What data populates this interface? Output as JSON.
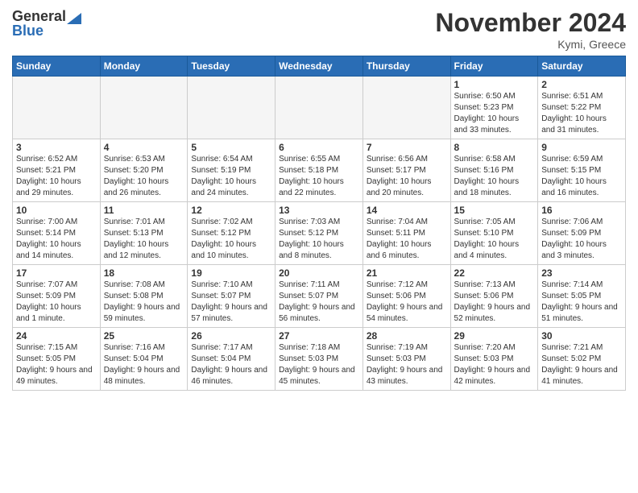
{
  "header": {
    "logo_general": "General",
    "logo_blue": "Blue",
    "title": "November 2024",
    "location": "Kymi, Greece"
  },
  "days_of_week": [
    "Sunday",
    "Monday",
    "Tuesday",
    "Wednesday",
    "Thursday",
    "Friday",
    "Saturday"
  ],
  "weeks": [
    [
      {
        "day": "",
        "empty": true
      },
      {
        "day": "",
        "empty": true
      },
      {
        "day": "",
        "empty": true
      },
      {
        "day": "",
        "empty": true
      },
      {
        "day": "",
        "empty": true
      },
      {
        "day": "1",
        "sunrise": "6:50 AM",
        "sunset": "5:23 PM",
        "daylight": "10 hours and 33 minutes."
      },
      {
        "day": "2",
        "sunrise": "6:51 AM",
        "sunset": "5:22 PM",
        "daylight": "10 hours and 31 minutes."
      }
    ],
    [
      {
        "day": "3",
        "sunrise": "6:52 AM",
        "sunset": "5:21 PM",
        "daylight": "10 hours and 29 minutes."
      },
      {
        "day": "4",
        "sunrise": "6:53 AM",
        "sunset": "5:20 PM",
        "daylight": "10 hours and 26 minutes."
      },
      {
        "day": "5",
        "sunrise": "6:54 AM",
        "sunset": "5:19 PM",
        "daylight": "10 hours and 24 minutes."
      },
      {
        "day": "6",
        "sunrise": "6:55 AM",
        "sunset": "5:18 PM",
        "daylight": "10 hours and 22 minutes."
      },
      {
        "day": "7",
        "sunrise": "6:56 AM",
        "sunset": "5:17 PM",
        "daylight": "10 hours and 20 minutes."
      },
      {
        "day": "8",
        "sunrise": "6:58 AM",
        "sunset": "5:16 PM",
        "daylight": "10 hours and 18 minutes."
      },
      {
        "day": "9",
        "sunrise": "6:59 AM",
        "sunset": "5:15 PM",
        "daylight": "10 hours and 16 minutes."
      }
    ],
    [
      {
        "day": "10",
        "sunrise": "7:00 AM",
        "sunset": "5:14 PM",
        "daylight": "10 hours and 14 minutes."
      },
      {
        "day": "11",
        "sunrise": "7:01 AM",
        "sunset": "5:13 PM",
        "daylight": "10 hours and 12 minutes."
      },
      {
        "day": "12",
        "sunrise": "7:02 AM",
        "sunset": "5:12 PM",
        "daylight": "10 hours and 10 minutes."
      },
      {
        "day": "13",
        "sunrise": "7:03 AM",
        "sunset": "5:12 PM",
        "daylight": "10 hours and 8 minutes."
      },
      {
        "day": "14",
        "sunrise": "7:04 AM",
        "sunset": "5:11 PM",
        "daylight": "10 hours and 6 minutes."
      },
      {
        "day": "15",
        "sunrise": "7:05 AM",
        "sunset": "5:10 PM",
        "daylight": "10 hours and 4 minutes."
      },
      {
        "day": "16",
        "sunrise": "7:06 AM",
        "sunset": "5:09 PM",
        "daylight": "10 hours and 3 minutes."
      }
    ],
    [
      {
        "day": "17",
        "sunrise": "7:07 AM",
        "sunset": "5:09 PM",
        "daylight": "10 hours and 1 minute."
      },
      {
        "day": "18",
        "sunrise": "7:08 AM",
        "sunset": "5:08 PM",
        "daylight": "9 hours and 59 minutes."
      },
      {
        "day": "19",
        "sunrise": "7:10 AM",
        "sunset": "5:07 PM",
        "daylight": "9 hours and 57 minutes."
      },
      {
        "day": "20",
        "sunrise": "7:11 AM",
        "sunset": "5:07 PM",
        "daylight": "9 hours and 56 minutes."
      },
      {
        "day": "21",
        "sunrise": "7:12 AM",
        "sunset": "5:06 PM",
        "daylight": "9 hours and 54 minutes."
      },
      {
        "day": "22",
        "sunrise": "7:13 AM",
        "sunset": "5:06 PM",
        "daylight": "9 hours and 52 minutes."
      },
      {
        "day": "23",
        "sunrise": "7:14 AM",
        "sunset": "5:05 PM",
        "daylight": "9 hours and 51 minutes."
      }
    ],
    [
      {
        "day": "24",
        "sunrise": "7:15 AM",
        "sunset": "5:05 PM",
        "daylight": "9 hours and 49 minutes."
      },
      {
        "day": "25",
        "sunrise": "7:16 AM",
        "sunset": "5:04 PM",
        "daylight": "9 hours and 48 minutes."
      },
      {
        "day": "26",
        "sunrise": "7:17 AM",
        "sunset": "5:04 PM",
        "daylight": "9 hours and 46 minutes."
      },
      {
        "day": "27",
        "sunrise": "7:18 AM",
        "sunset": "5:03 PM",
        "daylight": "9 hours and 45 minutes."
      },
      {
        "day": "28",
        "sunrise": "7:19 AM",
        "sunset": "5:03 PM",
        "daylight": "9 hours and 43 minutes."
      },
      {
        "day": "29",
        "sunrise": "7:20 AM",
        "sunset": "5:03 PM",
        "daylight": "9 hours and 42 minutes."
      },
      {
        "day": "30",
        "sunrise": "7:21 AM",
        "sunset": "5:02 PM",
        "daylight": "9 hours and 41 minutes."
      }
    ]
  ]
}
